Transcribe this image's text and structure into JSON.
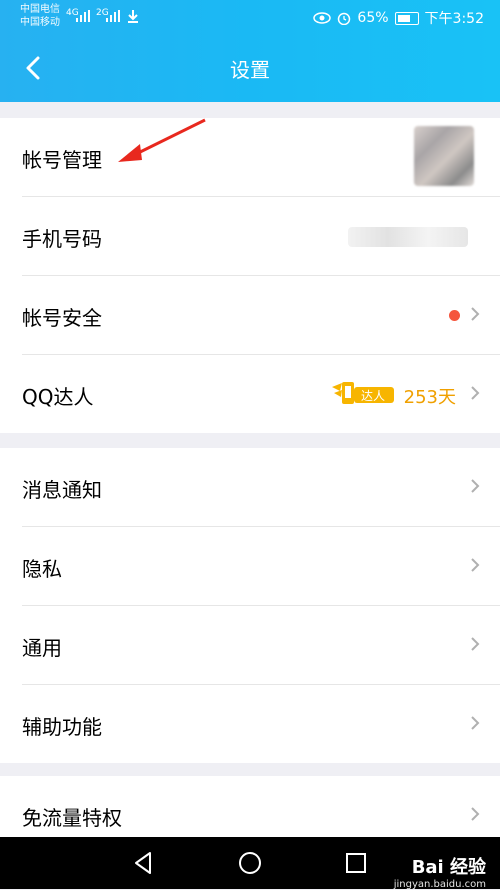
{
  "status_bar": {
    "carrier1": "中国电信",
    "carrier2": "中国移动",
    "net1": "4G",
    "net2": "2G",
    "battery": "65%",
    "time": "下午3:52"
  },
  "header": {
    "title": "设置"
  },
  "group1": [
    {
      "label": "帐号管理"
    },
    {
      "label": "手机号码"
    },
    {
      "label": "帐号安全"
    },
    {
      "label": "QQ达人",
      "badge_text": "达人",
      "days": "253天"
    }
  ],
  "group2": [
    {
      "label": "消息通知"
    },
    {
      "label": "隐私"
    },
    {
      "label": "通用"
    },
    {
      "label": "辅助功能"
    }
  ],
  "group3": [
    {
      "label": "免流量特权"
    }
  ],
  "watermark": {
    "brand": "Bai 经验",
    "url": "jingyan.baidu.com"
  },
  "colors": {
    "header_start": "#27b1f1",
    "header_end": "#19c2f6",
    "dot": "#f5553d",
    "days": "#f0a000",
    "arrow": "#e8281e"
  }
}
